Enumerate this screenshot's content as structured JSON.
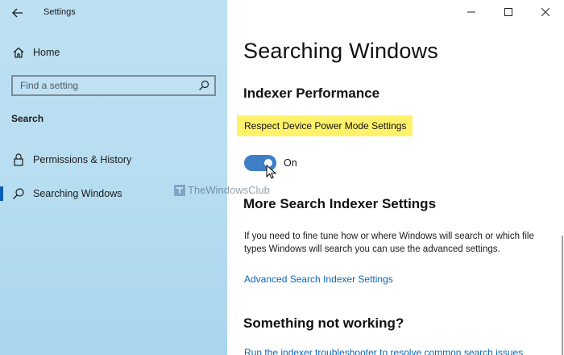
{
  "window": {
    "title": "Settings",
    "controls": {
      "minimize": "minimize",
      "maximize": "maximize",
      "close": "close"
    }
  },
  "sidebar": {
    "home_label": "Home",
    "search_placeholder": "Find a setting",
    "section_title": "Search",
    "items": [
      {
        "label": "Permissions & History",
        "icon": "lock-icon",
        "active": false
      },
      {
        "label": "Searching Windows",
        "icon": "search-icon",
        "active": true
      }
    ],
    "accent_color": "#0a5db5"
  },
  "main": {
    "page_title": "Searching Windows",
    "indexer_heading": "Indexer Performance",
    "power_mode_label": "Respect Device Power Mode Settings",
    "toggle": {
      "state": "On",
      "on": true
    },
    "more_heading": "More Search Indexer Settings",
    "more_description": "If you need to fine tune how or where Windows will search or which file types Windows will search you can use the advanced settings.",
    "advanced_link": "Advanced Search Indexer Settings",
    "not_working_heading": "Something not working?",
    "troubleshooter_link": "Run the indexer troubleshooter to resolve common search issues"
  },
  "watermark": {
    "text": "TheWindowsClub"
  },
  "colors": {
    "highlight": "#fff26b",
    "toggle_on": "#3e7fc7",
    "link": "#0a67b9"
  }
}
